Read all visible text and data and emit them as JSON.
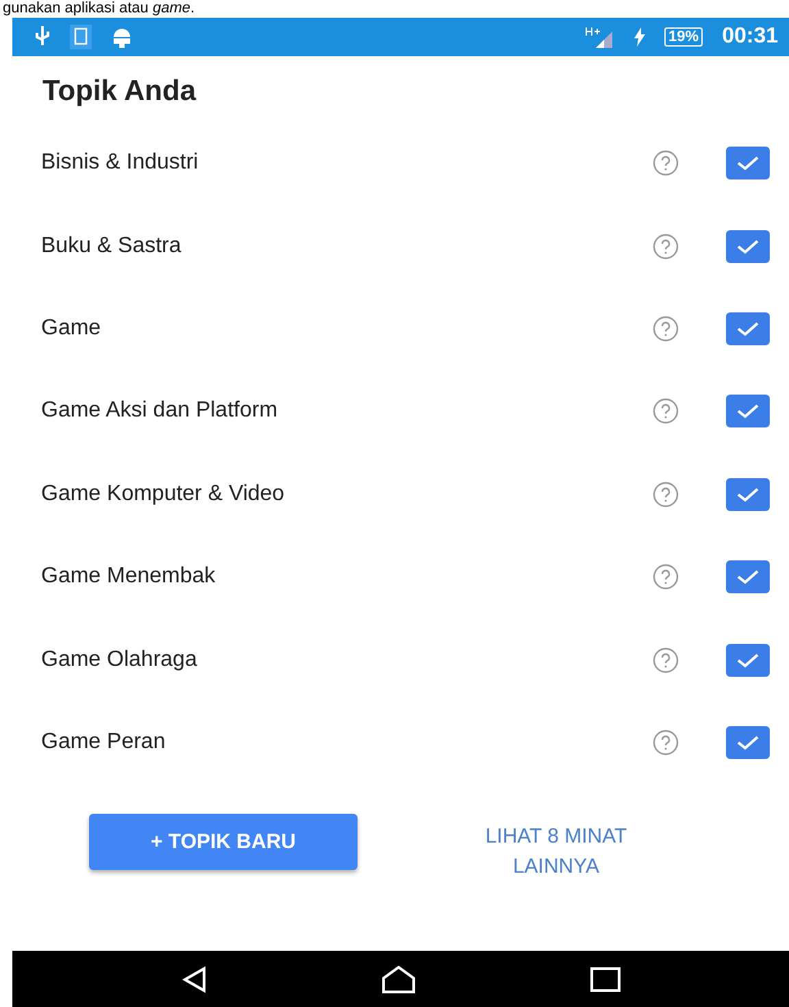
{
  "caption": "gunakan aplikasi atau *game*.",
  "status_bar": {
    "battery": "19%",
    "time": "00:31"
  },
  "title": "Topik Anda",
  "topics": [
    {
      "label": "Bisnis & Industri",
      "checked": true
    },
    {
      "label": "Buku & Sastra",
      "checked": true
    },
    {
      "label": "Game",
      "checked": true
    },
    {
      "label": "Game Aksi dan Platform",
      "checked": true
    },
    {
      "label": "Game Komputer & Video",
      "checked": true
    },
    {
      "label": "Game Menembak",
      "checked": true
    },
    {
      "label": "Game Olahraga",
      "checked": true
    },
    {
      "label": "Game Peran",
      "checked": true
    }
  ],
  "buttons": {
    "new_topic": "+ TOPIK BARU",
    "more": "LIHAT 8 MINAT LAINNYA"
  }
}
